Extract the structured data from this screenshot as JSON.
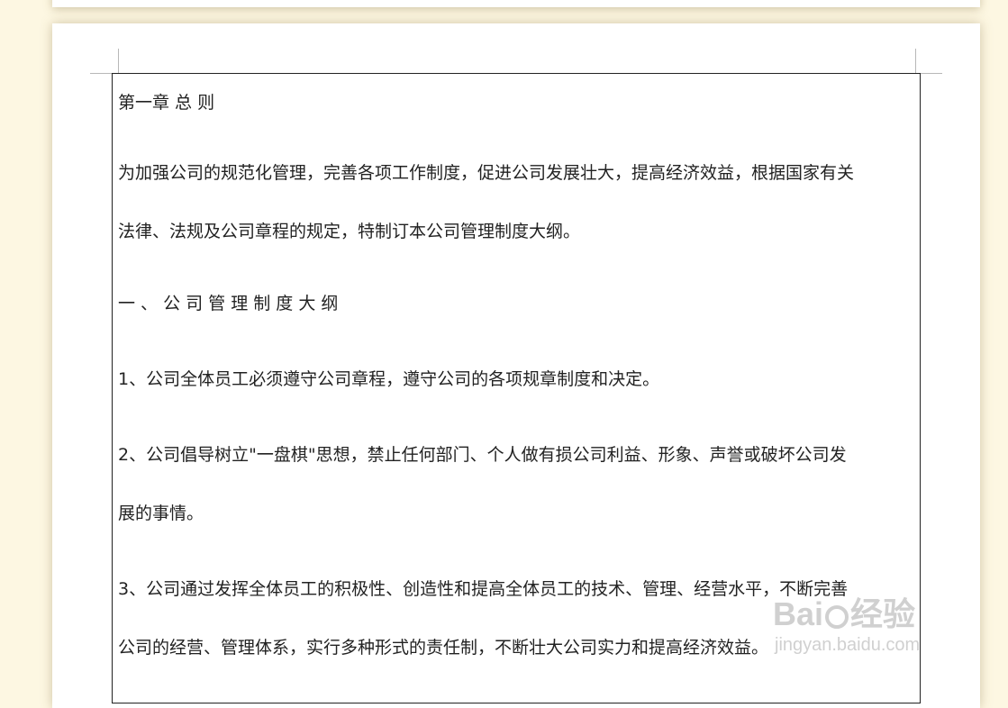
{
  "document": {
    "chapter_title": "第一章 总 则",
    "intro_line1": "为加强公司的规范化管理，完善各项工作制度，促进公司发展壮大，提高经济效益，根据国家有关",
    "intro_line2": "法律、法规及公司章程的规定，特制订本公司管理制度大纲。",
    "section_heading": "一 、 公 司 管 理 制 度 大 纲",
    "item1_line1": "1、公司全体员工必须遵守公司章程，遵守公司的各项规章制度和决定。",
    "item2_line1": "2、公司倡导树立\"一盘棋\"思想，禁止任何部门、个人做有损公司利益、形象、声誉或破坏公司发",
    "item2_line2": "展的事情。",
    "item3_line1": "3、公司通过发挥全体员工的积极性、创造性和提高全体员工的技术、管理、经营水平，不断完善",
    "item3_line2": "公司的经营、管理体系，实行多种形式的责任制，不断壮大公司实力和提高经济效益。"
  },
  "watermark": {
    "logo_text_left": "Bai",
    "logo_text_right": "经验",
    "url": "jingyan.baidu.com"
  },
  "colors": {
    "desk_background": "#fdf7e2",
    "page": "#ffffff",
    "text": "#222222"
  }
}
